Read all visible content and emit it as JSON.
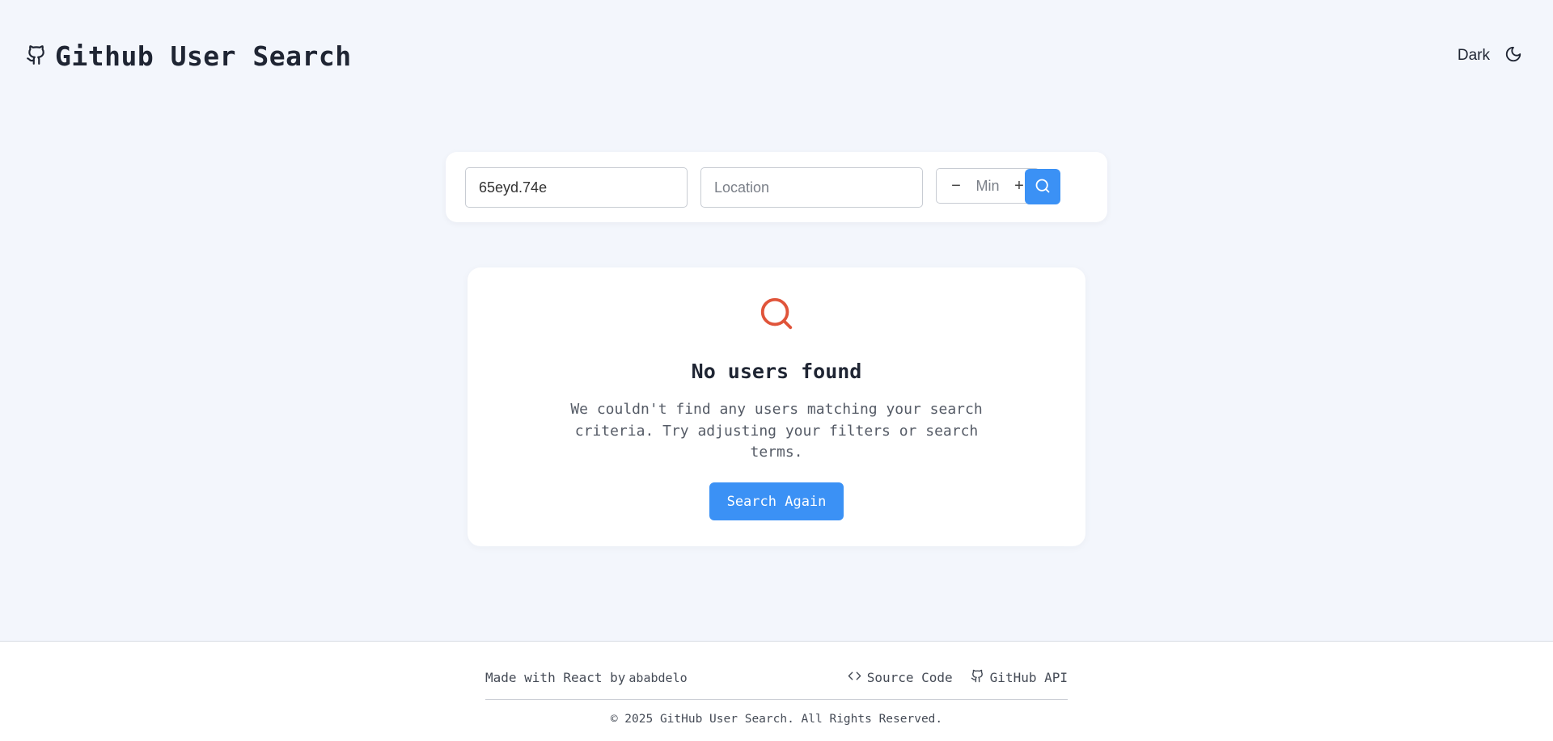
{
  "header": {
    "title": "Github User Search",
    "theme_label": "Dark"
  },
  "search": {
    "username_value": "65eyd.74e",
    "location_placeholder": "Location",
    "repos_min_label": "Min",
    "decrement_label": "−",
    "increment_label": "+"
  },
  "empty_state": {
    "title": "No users found",
    "message": "We couldn't find any users matching your search criteria. Try adjusting your filters or search terms.",
    "button_label": "Search Again"
  },
  "footer": {
    "made_with": "Made with React by",
    "author": "ababdelo",
    "source_label": "Source Code",
    "api_label": "GitHub API",
    "copyright": "© 2025 GitHub User Search. All Rights Reserved."
  },
  "icons": {
    "brand": "github-icon",
    "theme": "moon-icon",
    "search": "search-icon",
    "empty": "search-icon",
    "source": "code-icon",
    "api": "github-icon"
  },
  "colors": {
    "accent": "#3b91f5",
    "empty_icon": "#e0543a",
    "background": "#f3f6fc"
  }
}
